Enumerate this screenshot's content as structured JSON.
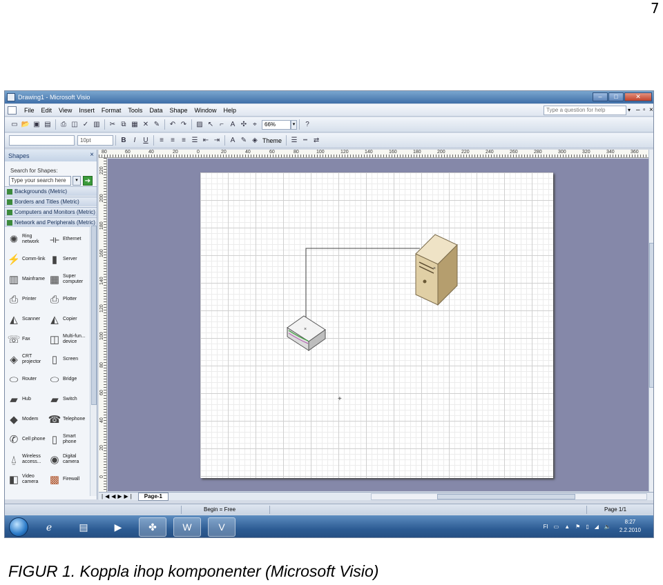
{
  "page_number": "7",
  "caption": "FIGUR 1. Koppla ihop komponenter (Microsoft Visio)",
  "window": {
    "title": "Drawing1 - Microsoft Visio",
    "controls": [
      "–",
      "□",
      "✕"
    ]
  },
  "menubar": {
    "items": [
      "File",
      "Edit",
      "View",
      "Insert",
      "Format",
      "Tools",
      "Data",
      "Shape",
      "Window",
      "Help"
    ],
    "help_placeholder": "Type a question for help"
  },
  "toolbar": {
    "zoom": "66%",
    "font_size": "10pt",
    "bold": "B",
    "italic": "I",
    "underline": "U",
    "theme_label": "Theme"
  },
  "shapes_pane": {
    "title": "Shapes",
    "search_label": "Search for Shapes:",
    "search_placeholder": "Type your search here",
    "stencils": [
      "Backgrounds (Metric)",
      "Borders and Titles (Metric)",
      "Computers and Monitors (Metric)",
      "Network and Peripherals (Metric)"
    ],
    "shapes": [
      [
        "Ring network",
        "Ethernet"
      ],
      [
        "Comm-link",
        "Server"
      ],
      [
        "Mainframe",
        "Super computer"
      ],
      [
        "Printer",
        "Plotter"
      ],
      [
        "Scanner",
        "Copier"
      ],
      [
        "Fax",
        "Multi-fun... device"
      ],
      [
        "CRT projector",
        "Screen"
      ],
      [
        "Router",
        "Bridge"
      ],
      [
        "Hub",
        "Switch"
      ],
      [
        "Modem",
        "Telephone"
      ],
      [
        "Cell phone",
        "Smart phone"
      ],
      [
        "Wireless access...",
        "Digital camera"
      ],
      [
        "Video camera",
        "Firewall"
      ]
    ]
  },
  "rulers": {
    "horizontal": [
      "80",
      "60",
      "40",
      "20",
      "0",
      "20",
      "40",
      "60",
      "80",
      "100",
      "120",
      "140",
      "160",
      "180",
      "200",
      "220",
      "240",
      "260",
      "280",
      "300",
      "320",
      "340",
      "360"
    ],
    "vertical": [
      "220",
      "200",
      "180",
      "160",
      "140",
      "120",
      "100",
      "80",
      "60",
      "40",
      "20",
      "0"
    ]
  },
  "page_tab": "Page-1",
  "statusbar": {
    "begin": "Begin = Free",
    "page": "Page 1/1"
  },
  "taskbar": {
    "tray_lang": "FI",
    "time": "8:27",
    "date": "2.2.2010"
  }
}
